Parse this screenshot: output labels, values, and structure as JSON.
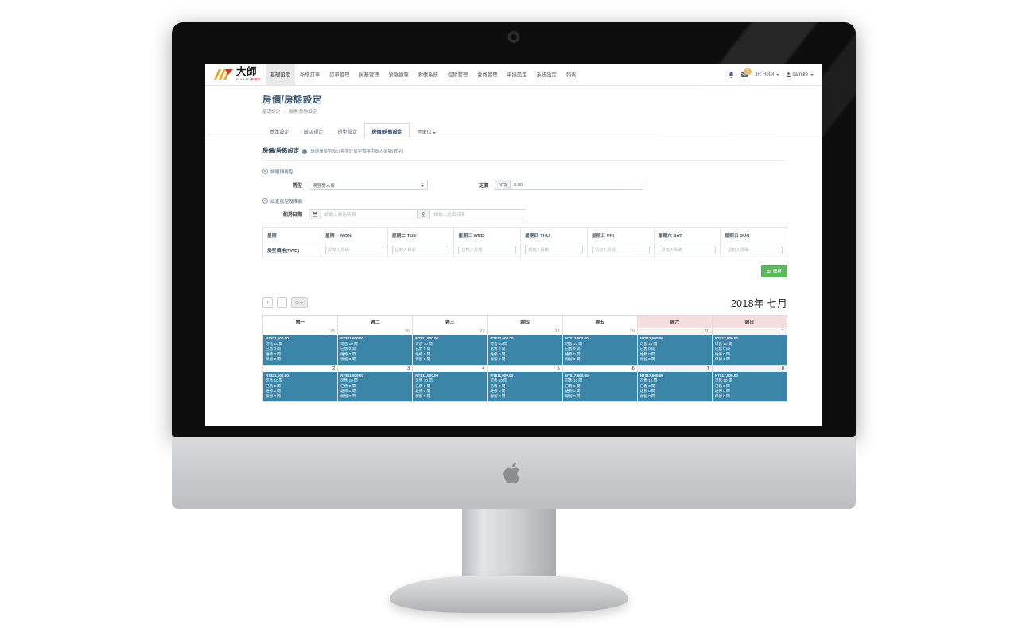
{
  "brand": {
    "cn": "大師",
    "en_prefix": "mastri",
    "en_suffix": "PMS"
  },
  "navbar": {
    "items": [
      {
        "label": "基礎設定",
        "active": true
      },
      {
        "label": "新增訂單",
        "active": false
      },
      {
        "label": "訂單管理",
        "active": false
      },
      {
        "label": "房務管理",
        "active": false
      },
      {
        "label": "緊急通報",
        "active": false
      },
      {
        "label": "對帳系統",
        "active": false
      },
      {
        "label": "促銷管理",
        "active": false
      },
      {
        "label": "會員管理",
        "active": false
      },
      {
        "label": "串接設定",
        "active": false
      },
      {
        "label": "系統設定",
        "active": false
      },
      {
        "label": "報表",
        "active": false
      }
    ],
    "bell_icon": "bell-icon",
    "mail_icon": "envelope-icon",
    "mail_badge": "3",
    "hotel": "JR Hotel",
    "user": "camille"
  },
  "page": {
    "title": "房價/房態設定",
    "breadcrumb": {
      "parent": "基礎設定",
      "sep": "/",
      "current": "房價/房態設定"
    }
  },
  "tabs": [
    {
      "label": "基本設定",
      "active": false
    },
    {
      "label": "飯店規定",
      "active": false
    },
    {
      "label": "房型設定",
      "active": false
    },
    {
      "label": "房價/房態設定",
      "active": true
    },
    {
      "label": "停車位",
      "active": false,
      "dropdown": true
    }
  ],
  "card": {
    "title": "房價/房態設定",
    "hint_icon": "info-icon",
    "hint": "請選擇房型及日期並於房型價格中輸入金額(數字)"
  },
  "form": {
    "section1_title": "請選擇房型",
    "roomtype_label": "房型",
    "roomtype_value": "摩登雙人房",
    "price_label": "定價",
    "price_currency": "NT$",
    "price_value": "0.00",
    "section2_title": "設定房型及間數",
    "date_label": "配房日期",
    "calendar_icon": "calendar-icon",
    "date_start_placeholder": "請輸入開始時間",
    "date_sep": "至",
    "date_end_placeholder": "請輸入結束時間"
  },
  "price_table": {
    "headers": [
      "星期",
      "星期一 MON",
      "星期二 TUE",
      "星期三 WED",
      "星期四 THU",
      "星期五 FRI",
      "星期六 SAT",
      "星期日 SUN"
    ],
    "row_label": "房型價格(TWD)",
    "cell_placeholder": "請輸入房價",
    "cells": [
      "",
      "",
      "",
      "",
      "",
      "",
      ""
    ]
  },
  "save_button": {
    "label": "儲存",
    "icon": "floppy-disk-icon",
    "color": "#5cb85c"
  },
  "calendar": {
    "prev_icon": "chevron-left-icon",
    "next_icon": "chevron-right-icon",
    "today_label": "今天",
    "title": "2018年 七月",
    "weekdays": [
      {
        "label": "週一",
        "weekend": false
      },
      {
        "label": "週二",
        "weekend": false
      },
      {
        "label": "週三",
        "weekend": false
      },
      {
        "label": "週四",
        "weekend": false
      },
      {
        "label": "週五",
        "weekend": false
      },
      {
        "label": "週六",
        "weekend": true
      },
      {
        "label": "週日",
        "weekend": true
      }
    ],
    "event_color": "#3a85a8",
    "labels": {
      "available": "可售",
      "sold": "已售",
      "maint": "維修",
      "hold": "保留",
      "unit": "間"
    },
    "weeks": [
      [
        {
          "day": "25",
          "current": false,
          "weekend": false,
          "price": "NT$11,500.00",
          "available": "10",
          "sold": "0",
          "maint": "0",
          "hold": "0"
        },
        {
          "day": "26",
          "current": false,
          "weekend": false,
          "price": "NT$11,500.00",
          "available": "10",
          "sold": "0",
          "maint": "0",
          "hold": "0"
        },
        {
          "day": "27",
          "current": false,
          "weekend": false,
          "price": "NT$11,500.00",
          "available": "10",
          "sold": "0",
          "maint": "0",
          "hold": "0"
        },
        {
          "day": "28",
          "current": false,
          "weekend": false,
          "price": "NT$17,500.00",
          "available": "10",
          "sold": "0",
          "maint": "0",
          "hold": "0"
        },
        {
          "day": "29",
          "current": false,
          "weekend": false,
          "price": "NT$17,500.00",
          "available": "10",
          "sold": "0",
          "maint": "0",
          "hold": "0"
        },
        {
          "day": "30",
          "current": false,
          "weekend": true,
          "price": "NT$17,500.00",
          "available": "10",
          "sold": "0",
          "maint": "0",
          "hold": "0"
        },
        {
          "day": "1",
          "current": true,
          "weekend": true,
          "price": "NT$17,500.00",
          "available": "10",
          "sold": "0",
          "maint": "0",
          "hold": "0"
        }
      ],
      [
        {
          "day": "2",
          "current": true,
          "weekend": false,
          "price": "NT$11,500.00",
          "available": "10",
          "sold": "0",
          "maint": "0",
          "hold": "0"
        },
        {
          "day": "3",
          "current": true,
          "weekend": false,
          "price": "NT$11,500.00",
          "available": "10",
          "sold": "0",
          "maint": "0",
          "hold": "0"
        },
        {
          "day": "4",
          "current": true,
          "weekend": false,
          "price": "NT$11,500.00",
          "available": "10",
          "sold": "0",
          "maint": "0",
          "hold": "0"
        },
        {
          "day": "5",
          "current": true,
          "weekend": false,
          "price": "NT$11,500.00",
          "available": "10",
          "sold": "0",
          "maint": "0",
          "hold": "0"
        },
        {
          "day": "6",
          "current": true,
          "weekend": false,
          "price": "NT$17,500.00",
          "available": "10",
          "sold": "0",
          "maint": "0",
          "hold": "0"
        },
        {
          "day": "7",
          "current": true,
          "weekend": true,
          "price": "NT$17,500.00",
          "available": "10",
          "sold": "0",
          "maint": "0",
          "hold": "0"
        },
        {
          "day": "8",
          "current": true,
          "weekend": true,
          "price": "NT$17,500.00",
          "available": "10",
          "sold": "0",
          "maint": "0",
          "hold": "0"
        }
      ]
    ]
  }
}
